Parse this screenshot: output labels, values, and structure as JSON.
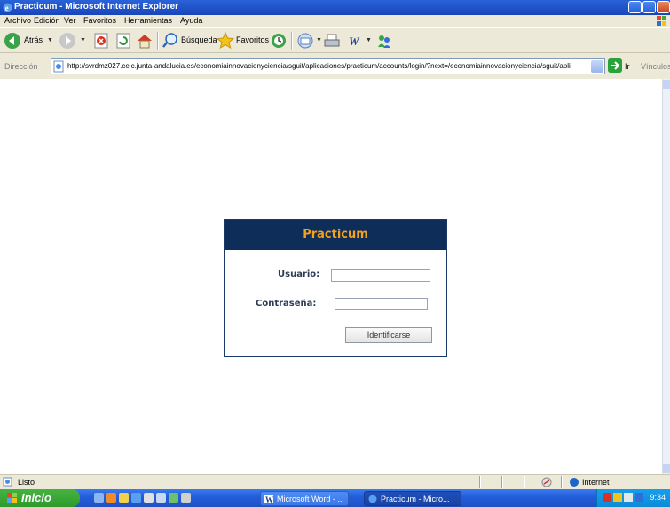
{
  "window": {
    "title": "Practicum - Microsoft Internet Explorer"
  },
  "menu": {
    "items": [
      "Archivo",
      "Edición",
      "Ver",
      "Favoritos",
      "Herramientas",
      "Ayuda"
    ]
  },
  "toolbar": {
    "back_label": "Atrás",
    "search_label": "Búsqueda",
    "favorites_label": "Favoritos"
  },
  "address": {
    "label": "Dirección",
    "url": "http://svrdmz027.ceic.junta-andalucia.es/economiainnovacionyciencia/sguit/aplicaciones/practicum/accounts/login/?next=/economiainnovacionyciencia/sguit/apli",
    "go_label": "Ir",
    "links_label": "Vínculos"
  },
  "login": {
    "heading": "Practicum",
    "username_label": "Usuario:",
    "username_value": "",
    "password_label": "Contraseña:",
    "password_value": "",
    "submit_label": "Identificarse"
  },
  "status": {
    "text": "Listo",
    "zone": "Internet"
  },
  "taskbar": {
    "start_label": "Inicio",
    "tasks": [
      {
        "label": "Microsoft Word - ..."
      },
      {
        "label": "Practicum - Micro..."
      }
    ],
    "clock": "9:34"
  },
  "colors": {
    "panel_header": "#0e2d58",
    "panel_title": "#f3a21b",
    "titlebar": "#1f52c9",
    "taskbar": "#245edb",
    "start_button": "#2f9a2c"
  }
}
